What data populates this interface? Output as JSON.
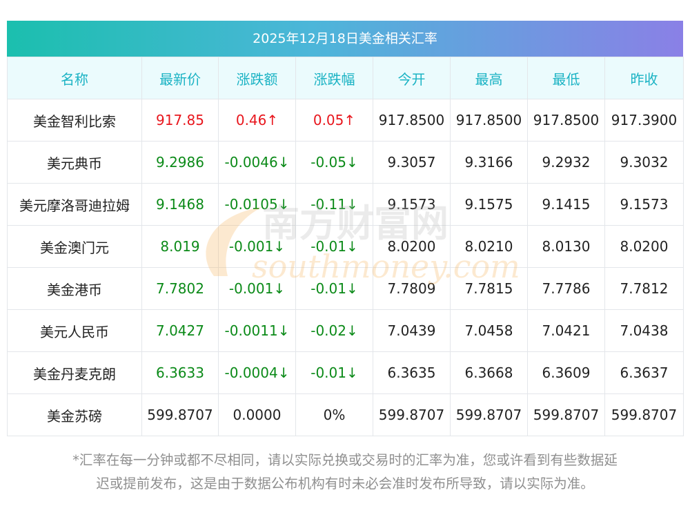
{
  "title": "2025年12月18日美金相关汇率",
  "headers": [
    "名称",
    "最新价",
    "涨跌额",
    "涨跌幅",
    "今开",
    "最高",
    "最低",
    "昨收"
  ],
  "rows": [
    {
      "name": "美金智利比索",
      "latest": "917.85",
      "change": "0.46↑",
      "pct": "0.05↑",
      "open": "917.8500",
      "high": "917.8500",
      "low": "917.8500",
      "prev": "917.3900",
      "trend": "up"
    },
    {
      "name": "美元典币",
      "latest": "9.2986",
      "change": "-0.0046↓",
      "pct": "-0.05↓",
      "open": "9.3057",
      "high": "9.3166",
      "low": "9.2932",
      "prev": "9.3032",
      "trend": "down"
    },
    {
      "name": "美元摩洛哥迪拉姆",
      "latest": "9.1468",
      "change": "-0.0105↓",
      "pct": "-0.11↓",
      "open": "9.1573",
      "high": "9.1575",
      "low": "9.1415",
      "prev": "9.1573",
      "trend": "down"
    },
    {
      "name": "美金澳门元",
      "latest": "8.019",
      "change": "-0.001↓",
      "pct": "-0.01↓",
      "open": "8.0200",
      "high": "8.0210",
      "low": "8.0130",
      "prev": "8.0200",
      "trend": "down"
    },
    {
      "name": "美金港币",
      "latest": "7.7802",
      "change": "-0.001↓",
      "pct": "-0.01↓",
      "open": "7.7809",
      "high": "7.7815",
      "low": "7.7786",
      "prev": "7.7812",
      "trend": "down"
    },
    {
      "name": "美元人民币",
      "latest": "7.0427",
      "change": "-0.0011↓",
      "pct": "-0.02↓",
      "open": "7.0439",
      "high": "7.0458",
      "low": "7.0421",
      "prev": "7.0438",
      "trend": "down"
    },
    {
      "name": "美金丹麦克朗",
      "latest": "6.3633",
      "change": "-0.0004↓",
      "pct": "-0.01↓",
      "open": "6.3635",
      "high": "6.3668",
      "low": "6.3609",
      "prev": "6.3637",
      "trend": "down"
    },
    {
      "name": "美金苏磅",
      "latest": "599.8707",
      "change": "0.0000",
      "pct": "0%",
      "open": "599.8707",
      "high": "599.8707",
      "low": "599.8707",
      "prev": "599.8707",
      "trend": "flat"
    }
  ],
  "watermark": {
    "cn": "南方财富网",
    "en": "southmoney.com",
    "color": "#f5b25a"
  },
  "note_line1": "*汇率在每一分钟或都不尽相同，请以实际兑换或交易时的汇率为准，您或许看到有些数据延",
  "note_line2": "迟或提前发布，这是由于数据公布机构有时未必会准时发布所导致，请以实际为准。",
  "colors": {
    "up": "#e8161d",
    "down": "#0b8a18",
    "header_text": "#1bb3c4"
  }
}
